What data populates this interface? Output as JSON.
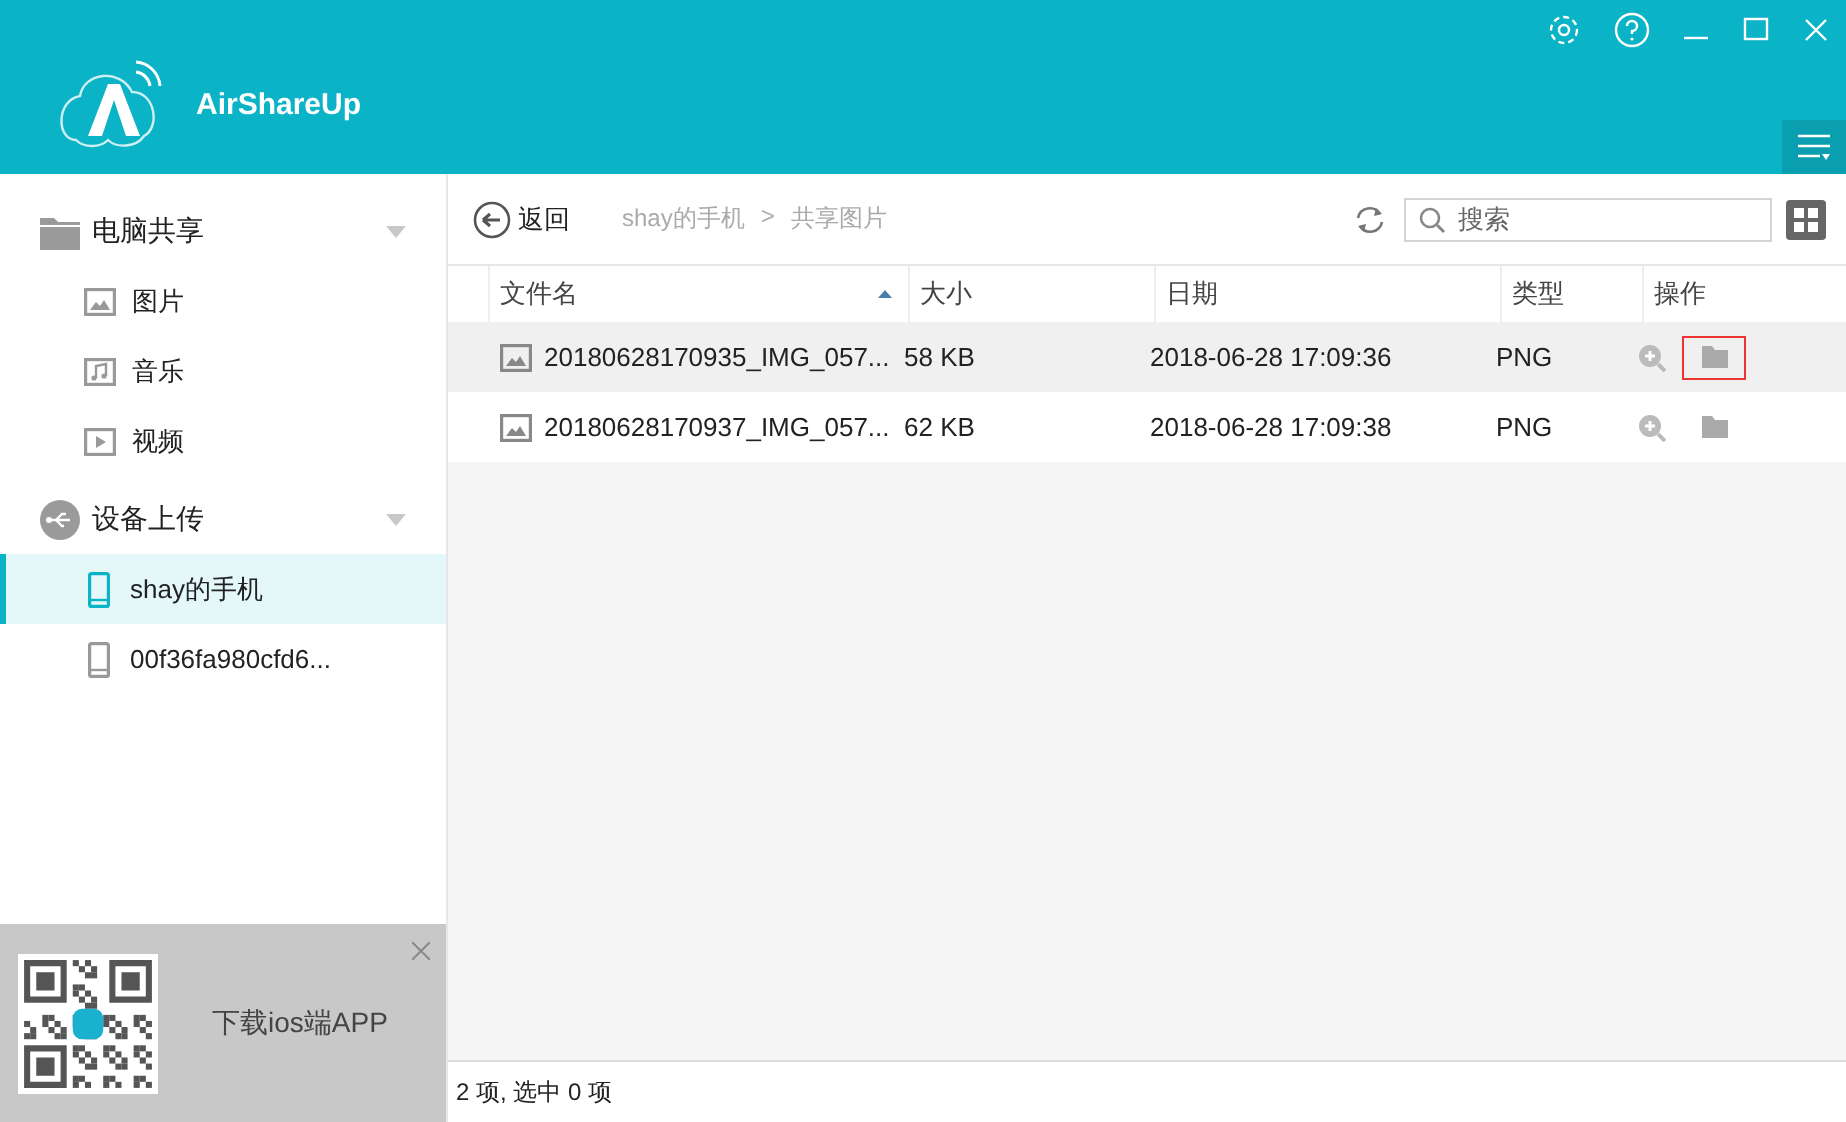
{
  "app": {
    "title": "AirShareUp"
  },
  "sidebar": {
    "sections": [
      {
        "label": "电脑共享",
        "kind": "folder",
        "expanded": true,
        "items": [
          {
            "label": "图片",
            "kind": "image",
            "selected": false
          },
          {
            "label": "音乐",
            "kind": "music",
            "selected": false
          },
          {
            "label": "视频",
            "kind": "video",
            "selected": false
          }
        ]
      },
      {
        "label": "设备上传",
        "kind": "usb",
        "expanded": true,
        "items": [
          {
            "label": "shay的手机",
            "kind": "phone",
            "selected": true
          },
          {
            "label": "00f36fa980cfd6...",
            "kind": "phone",
            "selected": false
          }
        ]
      }
    ]
  },
  "promo": {
    "text": "下载ios端APP"
  },
  "toolbar": {
    "back": "返回",
    "breadcrumb": [
      "shay的手机",
      "共享图片"
    ],
    "separator": ">",
    "search": {
      "placeholder": "搜索"
    }
  },
  "table": {
    "columns": [
      "文件名",
      "大小",
      "日期",
      "类型",
      "操作"
    ],
    "rows": [
      {
        "name": "20180628170935_IMG_057...",
        "size": "58 KB",
        "date": "2018-06-28 17:09:36",
        "type": "PNG",
        "hovered": true
      },
      {
        "name": "20180628170937_IMG_057...",
        "size": "62 KB",
        "date": "2018-06-28 17:09:38",
        "type": "PNG",
        "hovered": false
      }
    ]
  },
  "status_bar": "2 项, 选中 0 项"
}
